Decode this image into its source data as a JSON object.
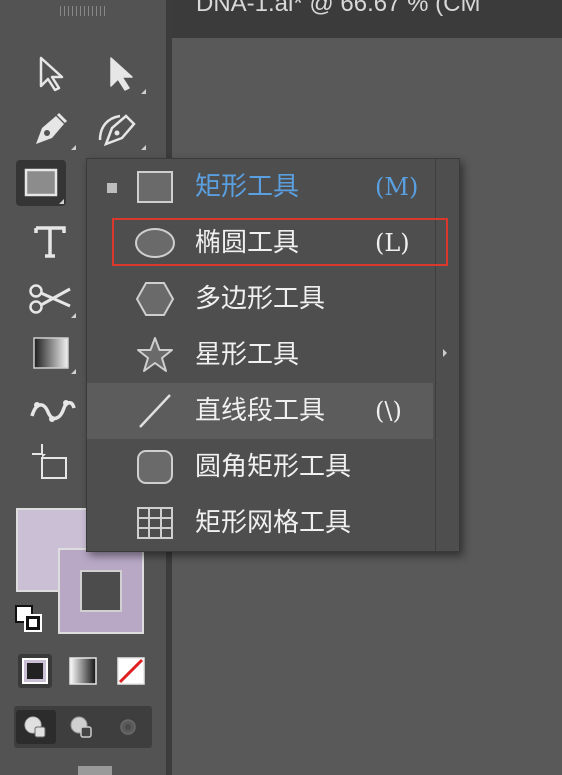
{
  "document": {
    "tab_title": "DNA-1.ai* @ 66.67 % (CM"
  },
  "toolbar": {
    "tools": [
      {
        "name": "selection-tool",
        "icon": "arrow-outline-icon"
      },
      {
        "name": "direct-selection-tool",
        "icon": "arrow-filled-icon"
      },
      {
        "name": "pen-tool",
        "icon": "pen-icon"
      },
      {
        "name": "curvature-tool",
        "icon": "curvature-pen-icon"
      },
      {
        "name": "rectangle-tool",
        "icon": "rectangle-icon",
        "active": true
      },
      {
        "name": "type-tool",
        "icon": "type-icon"
      },
      {
        "name": "scissors-tool",
        "icon": "scissors-icon"
      },
      {
        "name": "gradient-tool",
        "icon": "gradient-icon"
      },
      {
        "name": "puppet-warp-tool",
        "icon": "puppet-warp-icon"
      },
      {
        "name": "artboard-tool",
        "icon": "artboard-icon"
      }
    ],
    "fill_color": "#cbbfd6",
    "stroke_color": "#b8a8c6"
  },
  "flyout": {
    "items": [
      {
        "label": "矩形工具",
        "shortcut": "(M)",
        "icon": "rectangle-icon",
        "current": true
      },
      {
        "label": "椭圆工具",
        "shortcut": "(L)",
        "icon": "ellipse-icon",
        "highlighted": true
      },
      {
        "label": "多边形工具",
        "shortcut": "",
        "icon": "polygon-icon"
      },
      {
        "label": "星形工具",
        "shortcut": "",
        "icon": "star-icon"
      },
      {
        "label": "直线段工具",
        "shortcut": "(\\)",
        "icon": "line-segment-icon",
        "hover": true
      },
      {
        "label": "圆角矩形工具",
        "shortcut": "",
        "icon": "rounded-rectangle-icon"
      },
      {
        "label": "矩形网格工具",
        "shortcut": "",
        "icon": "rectangular-grid-icon"
      }
    ],
    "current_color": "#5a9fe0",
    "highlight_color": "#d9392c"
  }
}
